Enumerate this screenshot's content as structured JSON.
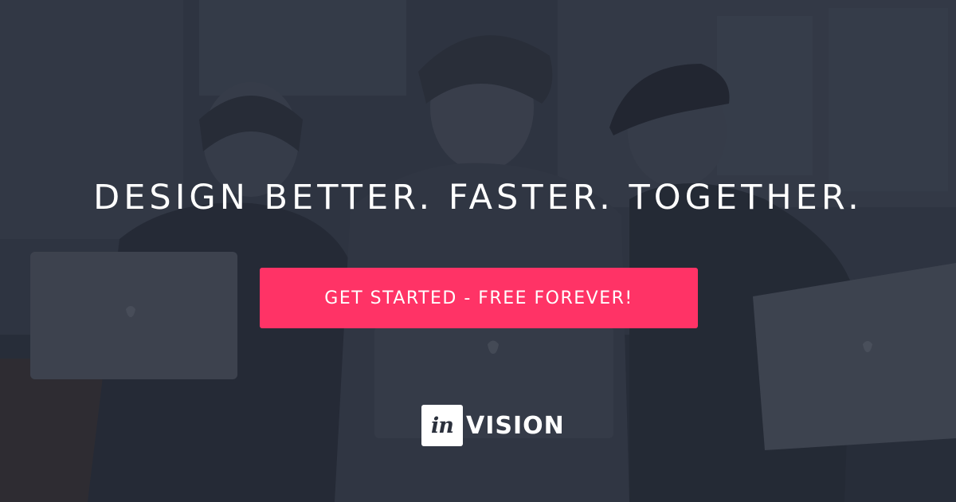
{
  "banner": {
    "headline": "DESIGN BETTER. FASTER. TOGETHER.",
    "cta_label": "GET STARTED - FREE FOREVER!",
    "cta_color": "#ff3366",
    "overlay_color": "#242936"
  },
  "logo": {
    "box_text": "in",
    "word_text": "VISION"
  },
  "photo": {
    "description_icon": "people-with-laptops-image"
  }
}
